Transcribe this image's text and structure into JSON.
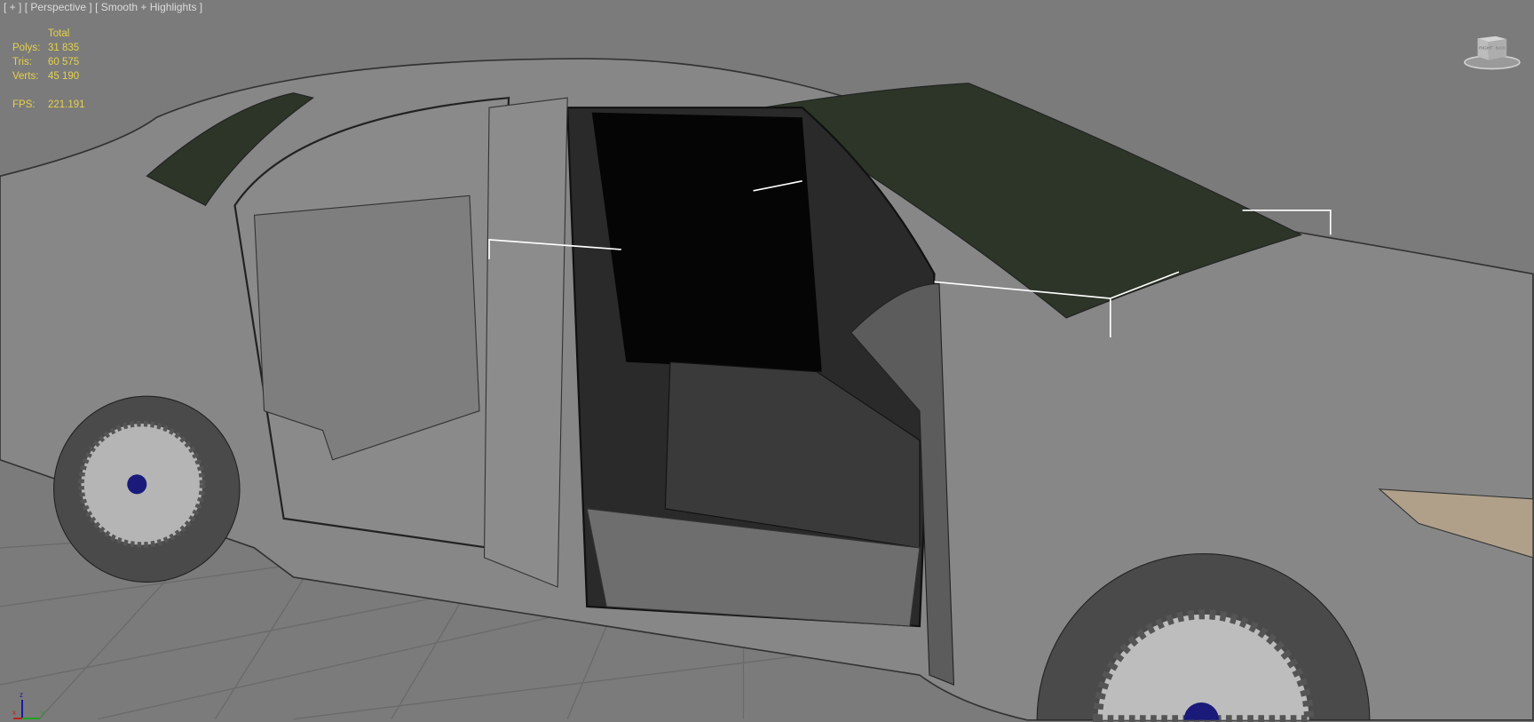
{
  "viewport": {
    "menu_label": "[ + ]",
    "view_label": "[ Perspective ]",
    "shading_label": "[ Smooth + Highlights ]"
  },
  "stats": {
    "header": "Total",
    "rows": [
      {
        "label": "Polys:",
        "value": "31 835"
      },
      {
        "label": "Tris:",
        "value": "60 575"
      },
      {
        "label": "Verts:",
        "value": "45 190"
      }
    ],
    "fps_label": "FPS:",
    "fps_value": "221.191"
  },
  "viewcube": {
    "face_front": "RIGHT",
    "face_side": "BACK"
  },
  "axis": {
    "x": "x",
    "y": "y",
    "z": "z"
  },
  "colors": {
    "background": "#7b7b7b",
    "stats_text": "#e6d24a",
    "label_text": "#dcdcdc"
  }
}
